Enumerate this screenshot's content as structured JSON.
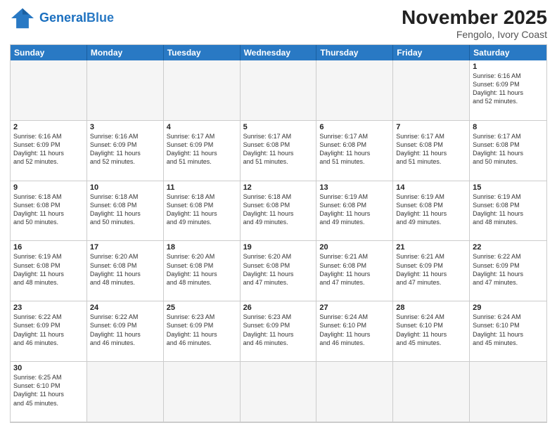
{
  "header": {
    "logo_general": "General",
    "logo_blue": "Blue",
    "month_title": "November 2025",
    "location": "Fengolo, Ivory Coast"
  },
  "day_headers": [
    "Sunday",
    "Monday",
    "Tuesday",
    "Wednesday",
    "Thursday",
    "Friday",
    "Saturday"
  ],
  "cells": [
    {
      "day": "",
      "info": "",
      "empty": true
    },
    {
      "day": "",
      "info": "",
      "empty": true
    },
    {
      "day": "",
      "info": "",
      "empty": true
    },
    {
      "day": "",
      "info": "",
      "empty": true
    },
    {
      "day": "",
      "info": "",
      "empty": true
    },
    {
      "day": "",
      "info": "",
      "empty": true
    },
    {
      "day": "1",
      "info": "Sunrise: 6:16 AM\nSunset: 6:09 PM\nDaylight: 11 hours\nand 52 minutes."
    },
    {
      "day": "2",
      "info": "Sunrise: 6:16 AM\nSunset: 6:09 PM\nDaylight: 11 hours\nand 52 minutes."
    },
    {
      "day": "3",
      "info": "Sunrise: 6:16 AM\nSunset: 6:09 PM\nDaylight: 11 hours\nand 52 minutes."
    },
    {
      "day": "4",
      "info": "Sunrise: 6:17 AM\nSunset: 6:09 PM\nDaylight: 11 hours\nand 51 minutes."
    },
    {
      "day": "5",
      "info": "Sunrise: 6:17 AM\nSunset: 6:08 PM\nDaylight: 11 hours\nand 51 minutes."
    },
    {
      "day": "6",
      "info": "Sunrise: 6:17 AM\nSunset: 6:08 PM\nDaylight: 11 hours\nand 51 minutes."
    },
    {
      "day": "7",
      "info": "Sunrise: 6:17 AM\nSunset: 6:08 PM\nDaylight: 11 hours\nand 51 minutes."
    },
    {
      "day": "8",
      "info": "Sunrise: 6:17 AM\nSunset: 6:08 PM\nDaylight: 11 hours\nand 50 minutes."
    },
    {
      "day": "9",
      "info": "Sunrise: 6:18 AM\nSunset: 6:08 PM\nDaylight: 11 hours\nand 50 minutes."
    },
    {
      "day": "10",
      "info": "Sunrise: 6:18 AM\nSunset: 6:08 PM\nDaylight: 11 hours\nand 50 minutes."
    },
    {
      "day": "11",
      "info": "Sunrise: 6:18 AM\nSunset: 6:08 PM\nDaylight: 11 hours\nand 49 minutes."
    },
    {
      "day": "12",
      "info": "Sunrise: 6:18 AM\nSunset: 6:08 PM\nDaylight: 11 hours\nand 49 minutes."
    },
    {
      "day": "13",
      "info": "Sunrise: 6:19 AM\nSunset: 6:08 PM\nDaylight: 11 hours\nand 49 minutes."
    },
    {
      "day": "14",
      "info": "Sunrise: 6:19 AM\nSunset: 6:08 PM\nDaylight: 11 hours\nand 49 minutes."
    },
    {
      "day": "15",
      "info": "Sunrise: 6:19 AM\nSunset: 6:08 PM\nDaylight: 11 hours\nand 48 minutes."
    },
    {
      "day": "16",
      "info": "Sunrise: 6:19 AM\nSunset: 6:08 PM\nDaylight: 11 hours\nand 48 minutes."
    },
    {
      "day": "17",
      "info": "Sunrise: 6:20 AM\nSunset: 6:08 PM\nDaylight: 11 hours\nand 48 minutes."
    },
    {
      "day": "18",
      "info": "Sunrise: 6:20 AM\nSunset: 6:08 PM\nDaylight: 11 hours\nand 48 minutes."
    },
    {
      "day": "19",
      "info": "Sunrise: 6:20 AM\nSunset: 6:08 PM\nDaylight: 11 hours\nand 47 minutes."
    },
    {
      "day": "20",
      "info": "Sunrise: 6:21 AM\nSunset: 6:08 PM\nDaylight: 11 hours\nand 47 minutes."
    },
    {
      "day": "21",
      "info": "Sunrise: 6:21 AM\nSunset: 6:09 PM\nDaylight: 11 hours\nand 47 minutes."
    },
    {
      "day": "22",
      "info": "Sunrise: 6:22 AM\nSunset: 6:09 PM\nDaylight: 11 hours\nand 47 minutes."
    },
    {
      "day": "23",
      "info": "Sunrise: 6:22 AM\nSunset: 6:09 PM\nDaylight: 11 hours\nand 46 minutes."
    },
    {
      "day": "24",
      "info": "Sunrise: 6:22 AM\nSunset: 6:09 PM\nDaylight: 11 hours\nand 46 minutes."
    },
    {
      "day": "25",
      "info": "Sunrise: 6:23 AM\nSunset: 6:09 PM\nDaylight: 11 hours\nand 46 minutes."
    },
    {
      "day": "26",
      "info": "Sunrise: 6:23 AM\nSunset: 6:09 PM\nDaylight: 11 hours\nand 46 minutes."
    },
    {
      "day": "27",
      "info": "Sunrise: 6:24 AM\nSunset: 6:10 PM\nDaylight: 11 hours\nand 46 minutes."
    },
    {
      "day": "28",
      "info": "Sunrise: 6:24 AM\nSunset: 6:10 PM\nDaylight: 11 hours\nand 45 minutes."
    },
    {
      "day": "29",
      "info": "Sunrise: 6:24 AM\nSunset: 6:10 PM\nDaylight: 11 hours\nand 45 minutes."
    },
    {
      "day": "30",
      "info": "Sunrise: 6:25 AM\nSunset: 6:10 PM\nDaylight: 11 hours\nand 45 minutes."
    },
    {
      "day": "",
      "info": "",
      "empty": true
    },
    {
      "day": "",
      "info": "",
      "empty": true
    },
    {
      "day": "",
      "info": "",
      "empty": true
    },
    {
      "day": "",
      "info": "",
      "empty": true
    },
    {
      "day": "",
      "info": "",
      "empty": true
    },
    {
      "day": "",
      "info": "",
      "empty": true
    }
  ]
}
